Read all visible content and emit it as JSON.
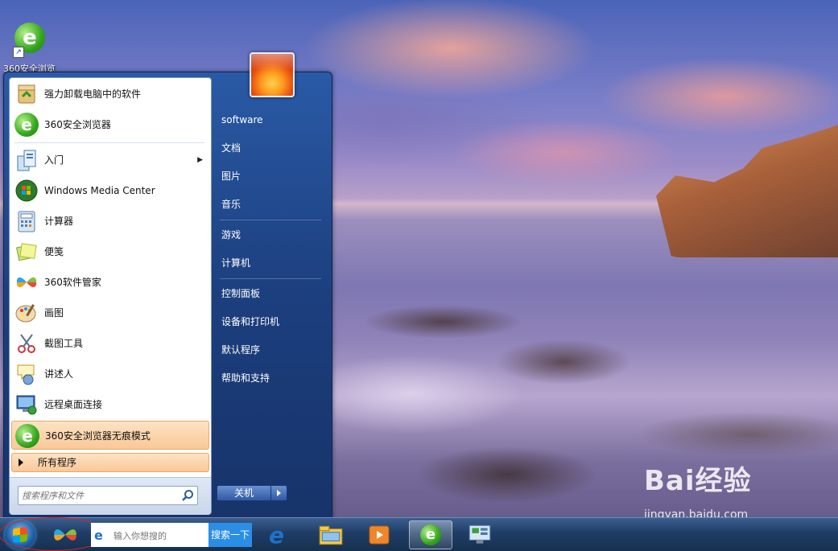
{
  "desktop": {
    "icons": [
      {
        "label": "360安全浏览",
        "icon": "360-browser-icon"
      }
    ]
  },
  "start_menu": {
    "programs": [
      {
        "label": "强力卸载电脑中的软件",
        "icon": "uninstall-icon"
      },
      {
        "label": "360安全浏览器",
        "icon": "360-browser-icon"
      },
      {
        "label": "入门",
        "icon": "getting-started-icon",
        "has_submenu": true
      },
      {
        "label": "Windows Media Center",
        "icon": "windows-media-center-icon"
      },
      {
        "label": "计算器",
        "icon": "calculator-icon"
      },
      {
        "label": "便笺",
        "icon": "sticky-notes-icon"
      },
      {
        "label": "360软件管家",
        "icon": "360-software-manager-icon"
      },
      {
        "label": "画图",
        "icon": "paint-icon"
      },
      {
        "label": "截图工具",
        "icon": "snipping-tool-icon"
      },
      {
        "label": "讲述人",
        "icon": "narrator-icon"
      },
      {
        "label": "远程桌面连接",
        "icon": "remote-desktop-icon"
      },
      {
        "label": "360安全浏览器无痕模式",
        "icon": "360-browser-incognito-icon",
        "highlighted": true
      }
    ],
    "all_programs_label": "所有程序",
    "search_placeholder": "搜索程序和文件",
    "right_items": [
      {
        "label": "software"
      },
      {
        "label": "文档"
      },
      {
        "label": "图片"
      },
      {
        "label": "音乐"
      },
      {
        "label": "游戏"
      },
      {
        "label": "计算机"
      },
      {
        "label": "控制面板"
      },
      {
        "label": "设备和打印机"
      },
      {
        "label": "默认程序"
      },
      {
        "label": "帮助和支持"
      }
    ],
    "shutdown_label": "关机"
  },
  "taskbar": {
    "search_placeholder": "输入你想搜的",
    "search_button": "搜索一下",
    "pinned": [
      {
        "name": "360-software-manager-icon"
      },
      {
        "name": "internet-explorer-icon"
      },
      {
        "name": "file-explorer-icon"
      },
      {
        "name": "media-player-icon"
      },
      {
        "name": "360-browser-icon",
        "active": true
      },
      {
        "name": "remote-desktop-icon"
      }
    ]
  },
  "watermark": {
    "brand": "Bai经验",
    "url": "jingyan.baidu.com"
  },
  "colors": {
    "taskbar": "#1f3d66",
    "start_menu": "#1c3f7e",
    "highlight": "#f9c898",
    "annotation_circle": "#e02020"
  }
}
